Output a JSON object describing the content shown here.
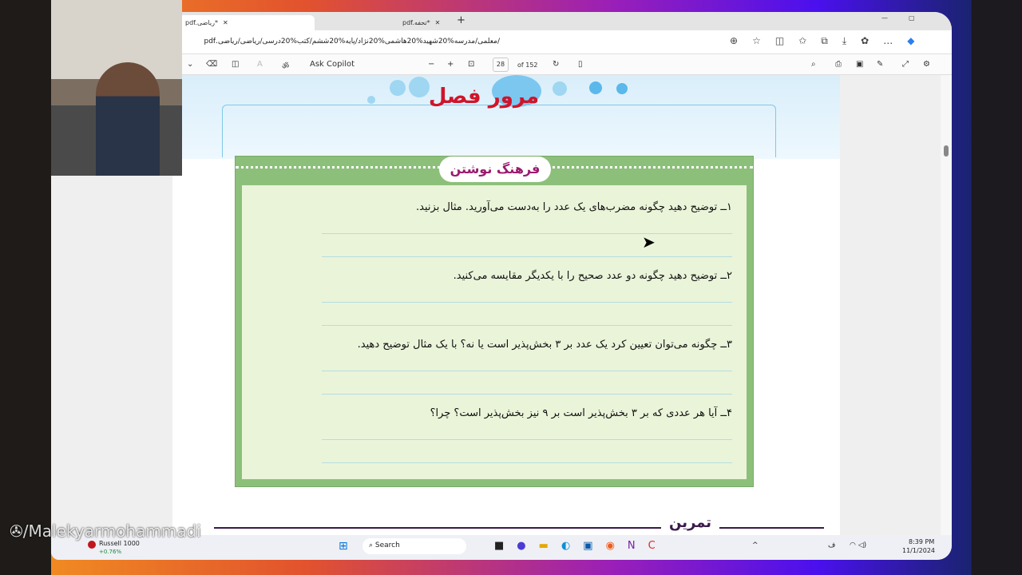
{
  "browser": {
    "tabs": [
      {
        "label": "pdf.ریاضی*"
      },
      {
        "label": "pdf.تحفه*"
      }
    ],
    "new_tab": "+",
    "url": "/معلمی/مدرسه%20شهید%20هاشمی%20نژاد/پایه%20ششم/کتب%20درسی/ریاضی/ریاضی.pdf",
    "window_controls": [
      "—",
      "▢"
    ]
  },
  "pdf_toolbar": {
    "ask_copilot": "Ask Copilot",
    "page_current": "28",
    "page_total": "of 152",
    "zoom_out": "−",
    "zoom_in": "+"
  },
  "page": {
    "title": "مرور فصل",
    "section": "فرهنگ نوشتن",
    "questions": [
      "۱ــ توضیح دهید چگونه مضرب‌های یک عدد را به‌دست می‌آورید. مثال بزنید.",
      "۲ــ توضیح دهید چگونه دو عدد صحیح را با یکدیگر مقایسه می‌کنید.",
      "۳ــ چگونه می‌توان تعیین کرد یک عدد بر ۳ بخش‌پذیر است یا نه؟ با یک مثال توضیح دهید.",
      "۴ــ آیا هر عددی که بر ۳ بخش‌پذیر است بر ۹ نیز بخش‌پذیر است؟ چرا؟"
    ],
    "next_section": "تمرین"
  },
  "taskbar": {
    "stock_name": "Russell 1000",
    "stock_change": "+0.76%",
    "search": "Search",
    "time": "8:39 PM",
    "date": "11/1/2024",
    "lang": "ف"
  },
  "watermark": "/Malekyarmohammadi",
  "colors": {
    "title": "#d0142a",
    "green": "#8cc07a",
    "accent": "#9b1a6e"
  }
}
